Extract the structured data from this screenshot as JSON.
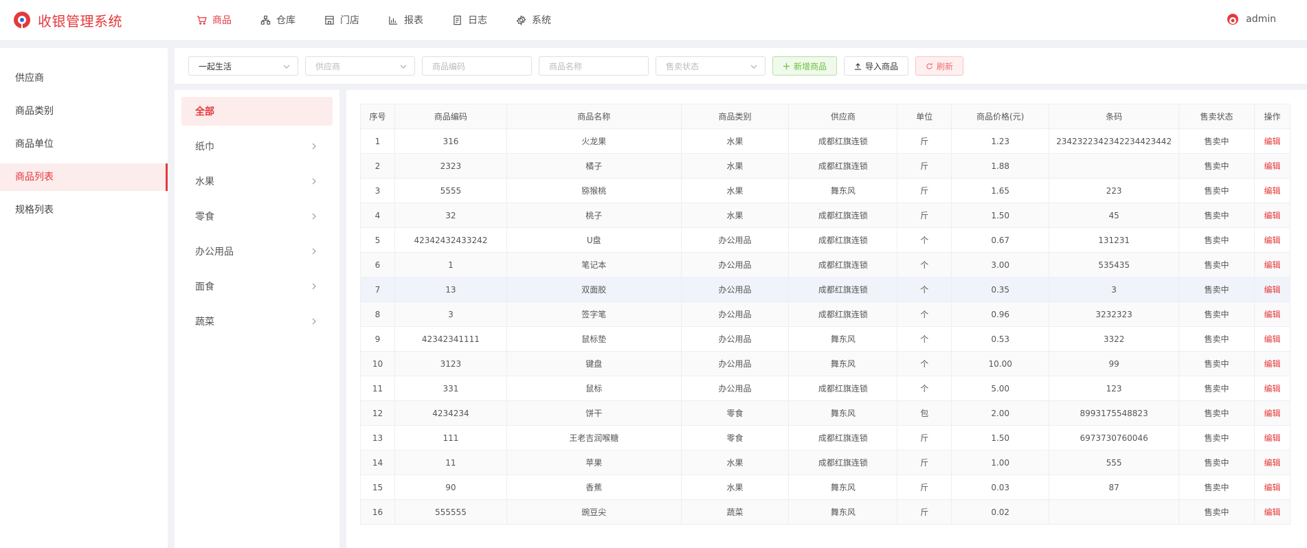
{
  "app": {
    "title": "收银管理系统",
    "brand_color": "#e4393c"
  },
  "nav": [
    {
      "label": "商品",
      "icon": "cart-icon",
      "active": true
    },
    {
      "label": "仓库",
      "icon": "warehouse-icon",
      "active": false
    },
    {
      "label": "门店",
      "icon": "store-icon",
      "active": false
    },
    {
      "label": "报表",
      "icon": "chart-icon",
      "active": false
    },
    {
      "label": "日志",
      "icon": "log-icon",
      "active": false
    },
    {
      "label": "系统",
      "icon": "gear-icon",
      "active": false
    }
  ],
  "user": {
    "name": "admin"
  },
  "sidebar": {
    "items": [
      {
        "label": "供应商"
      },
      {
        "label": "商品类别"
      },
      {
        "label": "商品单位"
      },
      {
        "label": "商品列表"
      },
      {
        "label": "规格列表"
      }
    ],
    "active_index": 3
  },
  "toolbar": {
    "store_select_value": "一起生活",
    "supplier_placeholder": "供应商",
    "code_placeholder": "商品编码",
    "name_placeholder": "商品名称",
    "status_placeholder": "售卖状态",
    "add_label": "新增商品",
    "import_label": "导入商品",
    "refresh_label": "刷新"
  },
  "categories": [
    {
      "label": "全部",
      "active": true
    },
    {
      "label": "纸巾"
    },
    {
      "label": "水果"
    },
    {
      "label": "零食"
    },
    {
      "label": "办公用品"
    },
    {
      "label": "面食"
    },
    {
      "label": "蔬菜"
    }
  ],
  "table": {
    "headers": [
      "序号",
      "商品编码",
      "商品名称",
      "商品类别",
      "供应商",
      "单位",
      "商品价格(元)",
      "条码",
      "售卖状态",
      "操作"
    ],
    "edit_label": "编辑",
    "rows": [
      [
        "1",
        "316",
        "火龙果",
        "水果",
        "成都红旗连锁",
        "斤",
        "1.23",
        "2342322342342234423442",
        "售卖中"
      ],
      [
        "2",
        "2323",
        "橘子",
        "水果",
        "成都红旗连锁",
        "斤",
        "1.88",
        "",
        "售卖中"
      ],
      [
        "3",
        "5555",
        "猕猴桃",
        "水果",
        "舞东风",
        "斤",
        "1.65",
        "223",
        "售卖中"
      ],
      [
        "4",
        "32",
        "桃子",
        "水果",
        "成都红旗连锁",
        "斤",
        "1.50",
        "45",
        "售卖中"
      ],
      [
        "5",
        "42342432433242",
        "U盘",
        "办公用品",
        "成都红旗连锁",
        "个",
        "0.67",
        "131231",
        "售卖中"
      ],
      [
        "6",
        "1",
        "笔记本",
        "办公用品",
        "成都红旗连锁",
        "个",
        "3.00",
        "535435",
        "售卖中"
      ],
      [
        "7",
        "13",
        "双面胶",
        "办公用品",
        "成都红旗连锁",
        "个",
        "0.35",
        "3",
        "售卖中"
      ],
      [
        "8",
        "3",
        "签字笔",
        "办公用品",
        "成都红旗连锁",
        "个",
        "0.96",
        "3232323",
        "售卖中"
      ],
      [
        "9",
        "42342341111",
        "鼠标垫",
        "办公用品",
        "舞东风",
        "个",
        "0.53",
        "3322",
        "售卖中"
      ],
      [
        "10",
        "3123",
        "键盘",
        "办公用品",
        "舞东风",
        "个",
        "10.00",
        "99",
        "售卖中"
      ],
      [
        "11",
        "331",
        "鼠标",
        "办公用品",
        "成都红旗连锁",
        "个",
        "5.00",
        "123",
        "售卖中"
      ],
      [
        "12",
        "4234234",
        "饼干",
        "零食",
        "舞东风",
        "包",
        "2.00",
        "8993175548823",
        "售卖中"
      ],
      [
        "13",
        "111",
        "王老吉润喉糖",
        "零食",
        "成都红旗连锁",
        "斤",
        "1.50",
        "6973730760046",
        "售卖中"
      ],
      [
        "14",
        "11",
        "苹果",
        "水果",
        "成都红旗连锁",
        "斤",
        "1.00",
        "555",
        "售卖中"
      ],
      [
        "15",
        "90",
        "香蕉",
        "水果",
        "舞东风",
        "斤",
        "0.03",
        "87",
        "售卖中"
      ],
      [
        "16",
        "555555",
        "豌豆尖",
        "蔬菜",
        "舞东风",
        "斤",
        "0.02",
        "",
        "售卖中"
      ]
    ]
  }
}
